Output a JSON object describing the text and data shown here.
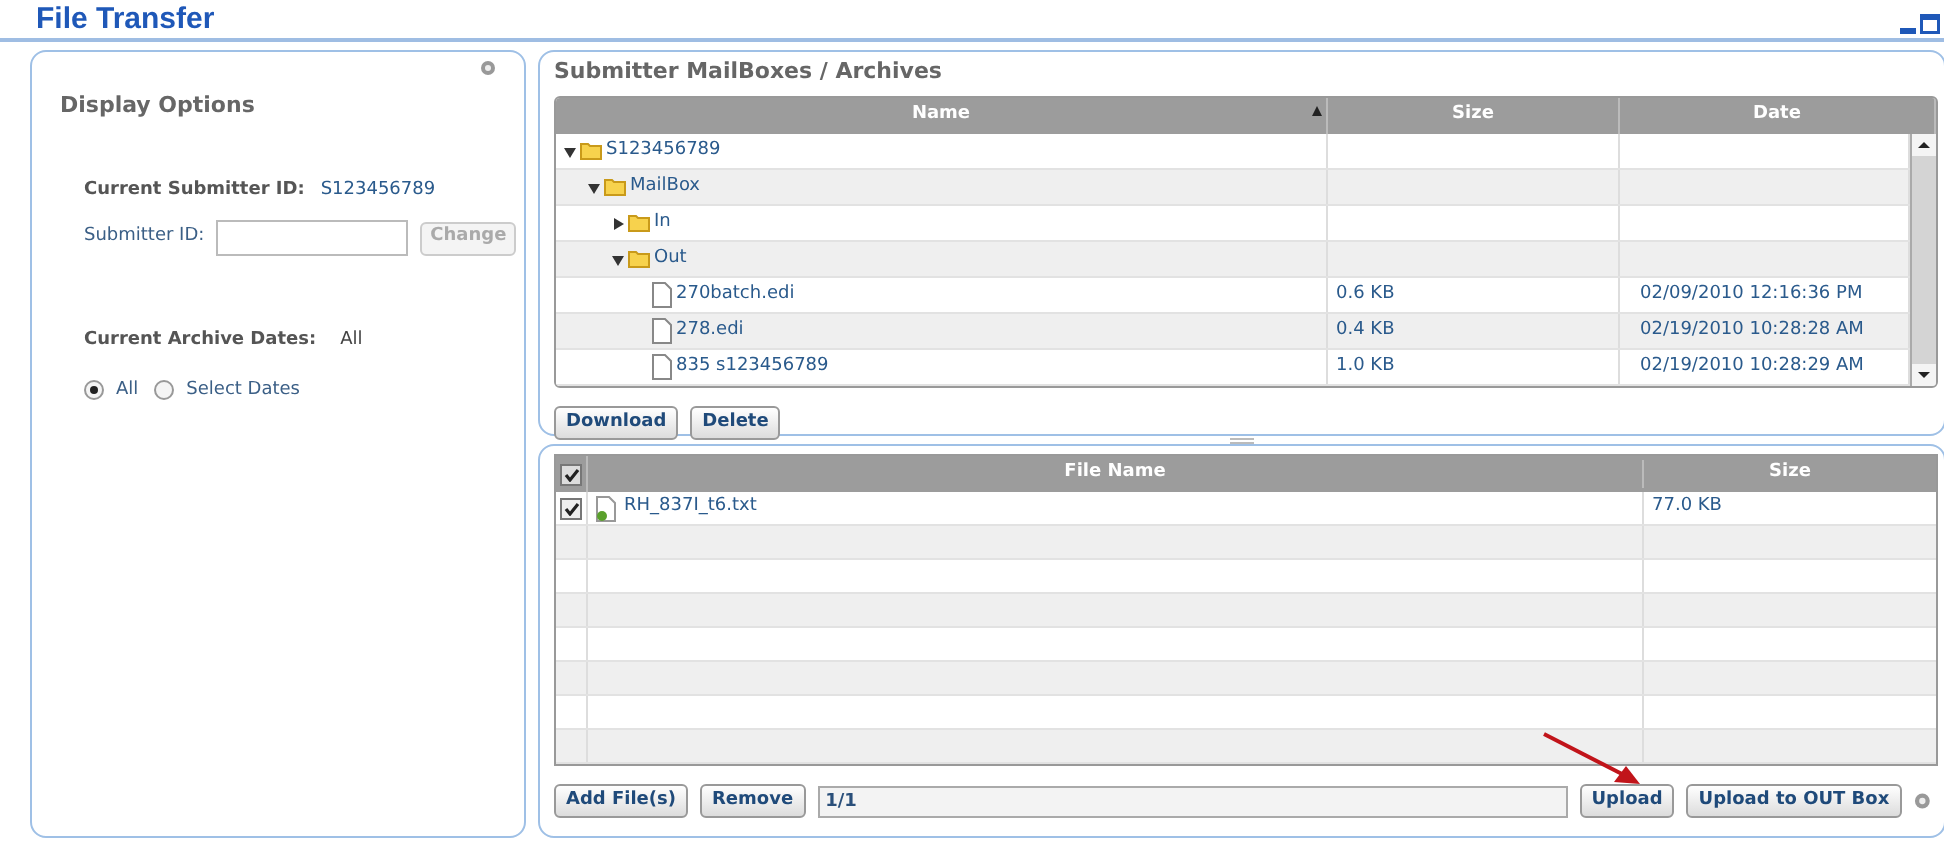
{
  "window": {
    "title": "File Transfer"
  },
  "display_options": {
    "title": "Display Options",
    "current_submitter_label": "Current Submitter ID:",
    "current_submitter_value": "S123456789",
    "submitter_field_label": "Submitter ID:",
    "change_button": {
      "label": "Change",
      "disabled": true
    },
    "archive_dates_label": "Current Archive Dates:",
    "archive_dates_value": "All",
    "date_options": [
      {
        "label": "All",
        "selected": true
      },
      {
        "label": "Select Dates",
        "selected": false
      }
    ]
  },
  "archives": {
    "title": "Submitter MailBoxes / Archives",
    "columns": [
      {
        "label": "Name",
        "sorted": true
      },
      {
        "label": "Size",
        "sorted": false
      },
      {
        "label": "Date",
        "sorted": false
      }
    ],
    "tree": [
      {
        "kind": "folder",
        "name": "S123456789",
        "expanded": true,
        "children": [
          {
            "kind": "folder",
            "name": "MailBox",
            "expanded": true,
            "children": [
              {
                "kind": "folder",
                "name": "In",
                "expanded": false
              },
              {
                "kind": "folder",
                "name": "Out",
                "expanded": true,
                "children": [
                  {
                    "kind": "file",
                    "name": "270batch.edi",
                    "size": "0.6 KB",
                    "date": "02/09/2010 12:16:36 PM"
                  },
                  {
                    "kind": "file",
                    "name": "278.edi",
                    "size": "0.4 KB",
                    "date": "02/19/2010 10:28:28 AM"
                  },
                  {
                    "kind": "file",
                    "name": "835 s123456789",
                    "size": "1.0 KB",
                    "date": "02/19/2010 10:28:29 AM"
                  }
                ]
              }
            ]
          }
        ]
      }
    ],
    "buttons": [
      "Download",
      "Delete"
    ]
  },
  "upload": {
    "all_checked": true,
    "columns": [
      "File Name",
      "Size"
    ],
    "files": [
      {
        "name": "RH_837I_t6.txt",
        "size": "77.0 KB",
        "checked": true
      }
    ],
    "left_buttons": [
      "Add File(s)",
      "Remove"
    ],
    "status": "1/1",
    "right_buttons": [
      "Upload",
      "Upload to OUT Box"
    ]
  }
}
